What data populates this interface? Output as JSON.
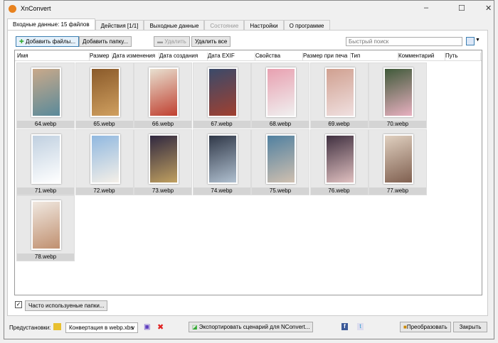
{
  "window": {
    "title": "XnConvert"
  },
  "tabs": [
    {
      "label": "Входные данные: 15 файлов",
      "active": true
    },
    {
      "label": "Действия [1/1]"
    },
    {
      "label": "Выходные данные"
    },
    {
      "label": "Состояние",
      "disabled": true
    },
    {
      "label": "Настройки"
    },
    {
      "label": "О программе"
    }
  ],
  "toolbar": {
    "add_files": "Добавить файлы...",
    "add_folder": "Добавить папку...",
    "remove": "Удалить",
    "remove_all": "Удалить все",
    "search_placeholder": "Быстрый поиск"
  },
  "columns": [
    "Имя",
    "Размер",
    "Дата изменения",
    "Дата создания",
    "Дата EXIF",
    "Свойства",
    "Размер при печа",
    "Тип",
    "Комментарий",
    "Путь"
  ],
  "files": [
    {
      "name": "64.webp",
      "colors": [
        "#c9a98a",
        "#5a8a9a"
      ]
    },
    {
      "name": "65.webp",
      "colors": [
        "#8a5a2a",
        "#d0a060"
      ]
    },
    {
      "name": "66.webp",
      "colors": [
        "#e8e0d0",
        "#c04030"
      ]
    },
    {
      "name": "67.webp",
      "colors": [
        "#3a4a6a",
        "#a04030"
      ]
    },
    {
      "name": "68.webp",
      "colors": [
        "#e8a0b0",
        "#f0f0f0"
      ]
    },
    {
      "name": "69.webp",
      "colors": [
        "#d0a090",
        "#f0e0e0"
      ]
    },
    {
      "name": "70.webp",
      "colors": [
        "#405a3a",
        "#e8b0c0"
      ]
    },
    {
      "name": "71.webp",
      "colors": [
        "#c0d0e0",
        "#ffffff"
      ]
    },
    {
      "name": "72.webp",
      "colors": [
        "#90b8e0",
        "#f5f0e8"
      ]
    },
    {
      "name": "73.webp",
      "colors": [
        "#302840",
        "#c0a060"
      ]
    },
    {
      "name": "74.webp",
      "colors": [
        "#303848",
        "#b0c0d0"
      ]
    },
    {
      "name": "75.webp",
      "colors": [
        "#5080a0",
        "#d0c0b0"
      ]
    },
    {
      "name": "76.webp",
      "colors": [
        "#403040",
        "#e0c0c0"
      ]
    },
    {
      "name": "77.webp",
      "colors": [
        "#e0d0c0",
        "#806050"
      ]
    },
    {
      "name": "78.webp",
      "colors": [
        "#f0e8e0",
        "#c09070"
      ]
    }
  ],
  "bottom": {
    "frequent_folders": "Часто используеные папки...",
    "frequent_checked": true,
    "presets_label": "Предустановки:",
    "preset_value": "Конвертация в webp.xbs",
    "export": "Экспортировать сценарий для NConvert...",
    "convert": "Преобразовать",
    "close": "Закрыть"
  }
}
